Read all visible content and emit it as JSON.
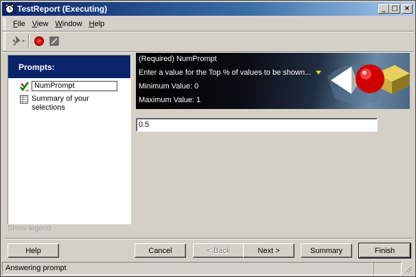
{
  "window": {
    "title": "TestReport (Executing)",
    "minimize_glyph": "_",
    "maximize_glyph": "□",
    "close_glyph": "×"
  },
  "menu": {
    "items": [
      {
        "label": "File",
        "accel": "F",
        "rest": "ile"
      },
      {
        "label": "View",
        "accel": "V",
        "rest": "iew"
      },
      {
        "label": "Window",
        "accel": "W",
        "rest": "indow"
      },
      {
        "label": "Help",
        "accel": "H",
        "rest": "elp"
      }
    ]
  },
  "toolbar": {
    "icons": [
      "tools-icon",
      "record-icon",
      "stop-icon"
    ]
  },
  "left_panel": {
    "header": "Prompts:",
    "items": [
      {
        "label": "NumPrompt",
        "icon": "check-pencil-icon"
      },
      {
        "label": "Summary of your selections",
        "icon": "summary-icon"
      }
    ],
    "show_legend": "Show legend"
  },
  "banner": {
    "title": "(Required) NumPrompt",
    "instruction": "Enter a value for the Top % of values to be shown...",
    "min_label": "Minimum Value: 0",
    "max_label": "Maximum Value: 1"
  },
  "input": {
    "value": "0.5"
  },
  "buttons": {
    "help": "Help",
    "cancel": "Cancel",
    "back": "< Back",
    "next": "Next >",
    "summary": "Summary",
    "finish": "Finish"
  },
  "status": {
    "text": "Answering prompt"
  },
  "colors": {
    "title_bar": "#0a246a",
    "prompts_header": "#0a246a",
    "window_bg": "#d4d0c8"
  }
}
